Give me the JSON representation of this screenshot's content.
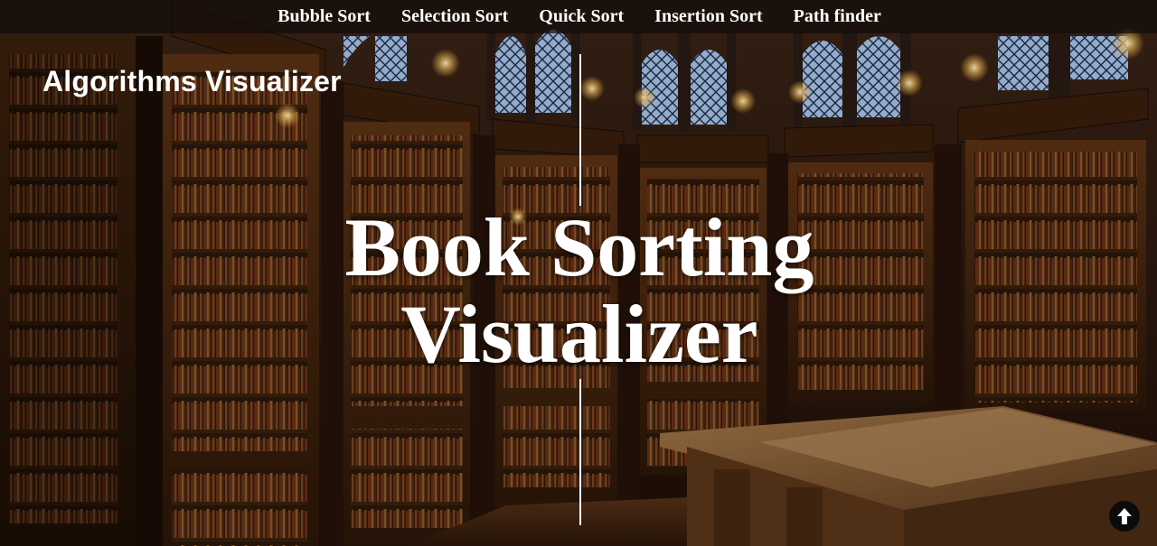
{
  "nav": {
    "items": [
      {
        "label": "Bubble Sort"
      },
      {
        "label": "Selection Sort"
      },
      {
        "label": "Quick Sort"
      },
      {
        "label": "Insertion Sort"
      },
      {
        "label": "Path finder"
      }
    ]
  },
  "brand": {
    "title": "Algorithms Visualizer"
  },
  "hero": {
    "line1": "Book Sorting",
    "line2": "Visualizer"
  },
  "scroll_top": {
    "icon": "arrow-up-icon"
  },
  "colors": {
    "nav_bg": "#120c0a",
    "text": "#ffffff",
    "wood_dark": "#2a1608",
    "wood_mid": "#6b3a16",
    "window_glass": "#b8cfe8",
    "lamp": "#ffd98a"
  }
}
